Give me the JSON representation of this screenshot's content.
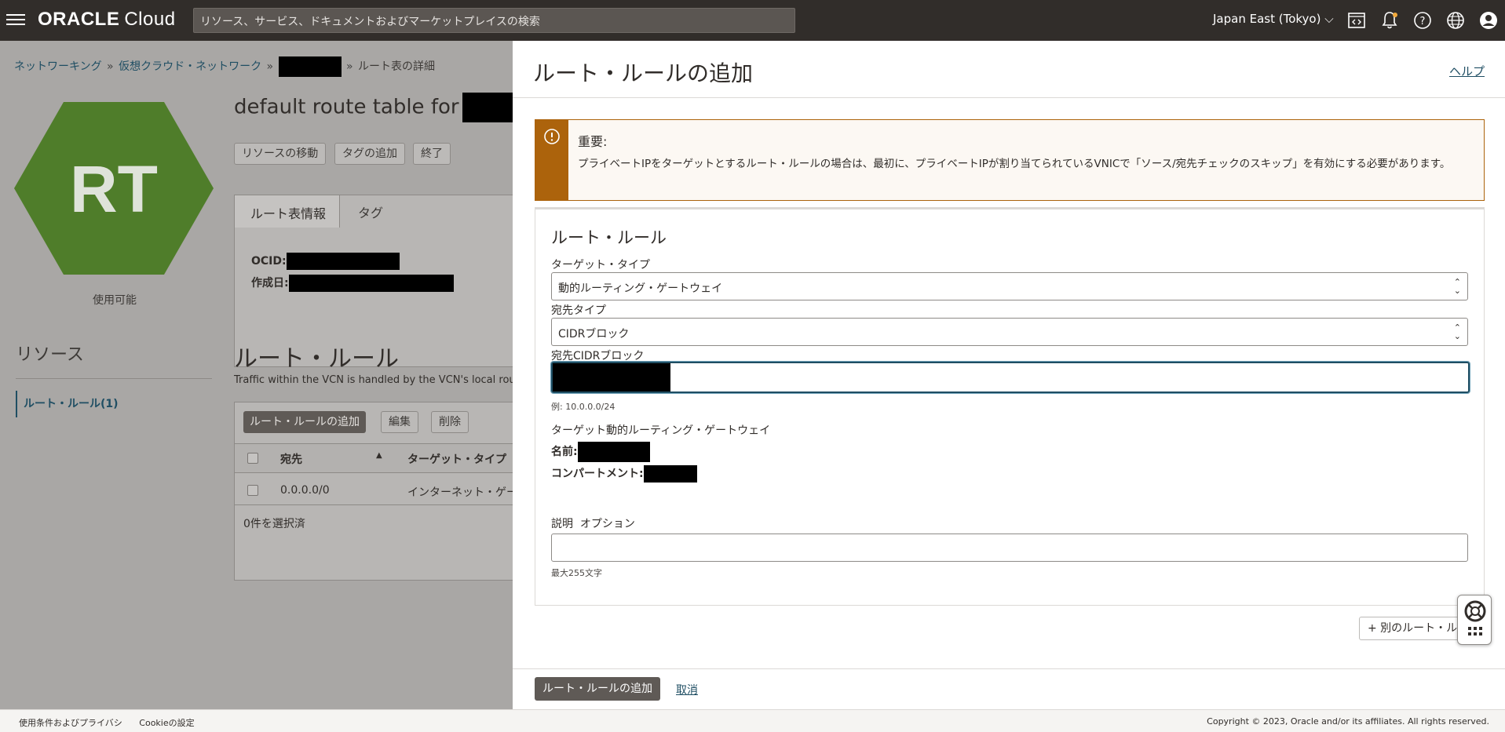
{
  "topbar": {
    "logo_brand": "ORACLE",
    "logo_product": "Cloud",
    "search_placeholder": "リソース、サービス、ドキュメントおよびマーケットプレイスの検索",
    "region": "Japan East (Tokyo)",
    "icons": [
      "menu-icon",
      "code-editor-icon",
      "notifications-icon",
      "help-icon",
      "language-icon",
      "profile-icon"
    ]
  },
  "breadcrumb": {
    "items": [
      "ネットワーキング",
      "仮想クラウド・ネットワーク"
    ],
    "current": "ルート表の詳細",
    "separator": "»"
  },
  "resource": {
    "badge": "RT",
    "badge_color": "#4f7d2a",
    "status": "使用可能",
    "title": "default route table for",
    "buttons": [
      "リソースの移動",
      "タグの追加",
      "終了"
    ],
    "tabs": [
      "ルート表情報",
      "タグ"
    ],
    "ocid_label": "OCID:",
    "created_label": "作成日:"
  },
  "resources_nav": {
    "title": "リソース",
    "item": "ルート・ルール(1)"
  },
  "route_rules_section": {
    "title": "ルート・ルール",
    "description": "Traffic within the VCN is handled by the VCN's local routing table",
    "buttons": [
      "ルート・ルールの追加",
      "編集",
      "削除"
    ],
    "columns": [
      "宛先",
      "ターゲット・タイプ"
    ],
    "rows": [
      {
        "destination": "0.0.0.0/0",
        "target_type": "インターネット・ゲートウェイ"
      }
    ],
    "selection": "0件を選択済"
  },
  "panel": {
    "title": "ルート・ルールの追加",
    "help": "ヘルプ",
    "warning_title": "重要:",
    "warning_text": "プライベートIPをターゲットとするルート・ルールの場合は、最初に、プライベートIPが割り当てられているVNICで「ソース/宛先チェックのスキップ」を有効にする必要があります。",
    "warning_color": "#ac630c",
    "form": {
      "section_title": "ルート・ルール",
      "target_type_label": "ターゲット・タイプ",
      "target_type_value": "動的ルーティング・ゲートウェイ",
      "dest_type_label": "宛先タイプ",
      "dest_type_value": "CIDRブロック",
      "dest_cidr_label": "宛先CIDRブロック",
      "dest_cidr_hint": "例: 10.0.0.0/24",
      "target_drg_label": "ターゲット動的ルーティング・ゲートウェイ",
      "name_label": "名前:",
      "compartment_label": "コンパートメント:",
      "description_label": "説明",
      "description_optional": "オプション",
      "description_hint": "最大255文字"
    },
    "another_rule_button": "+ 別のルート・ルール",
    "submit_button": "ルート・ルールの追加",
    "cancel_link": "取消"
  },
  "footer": {
    "links": [
      "使用条件およびプライバシ",
      "Cookieの設定"
    ],
    "copyright": "Copyright © 2023, Oracle and/or its affiliates. All rights reserved."
  }
}
